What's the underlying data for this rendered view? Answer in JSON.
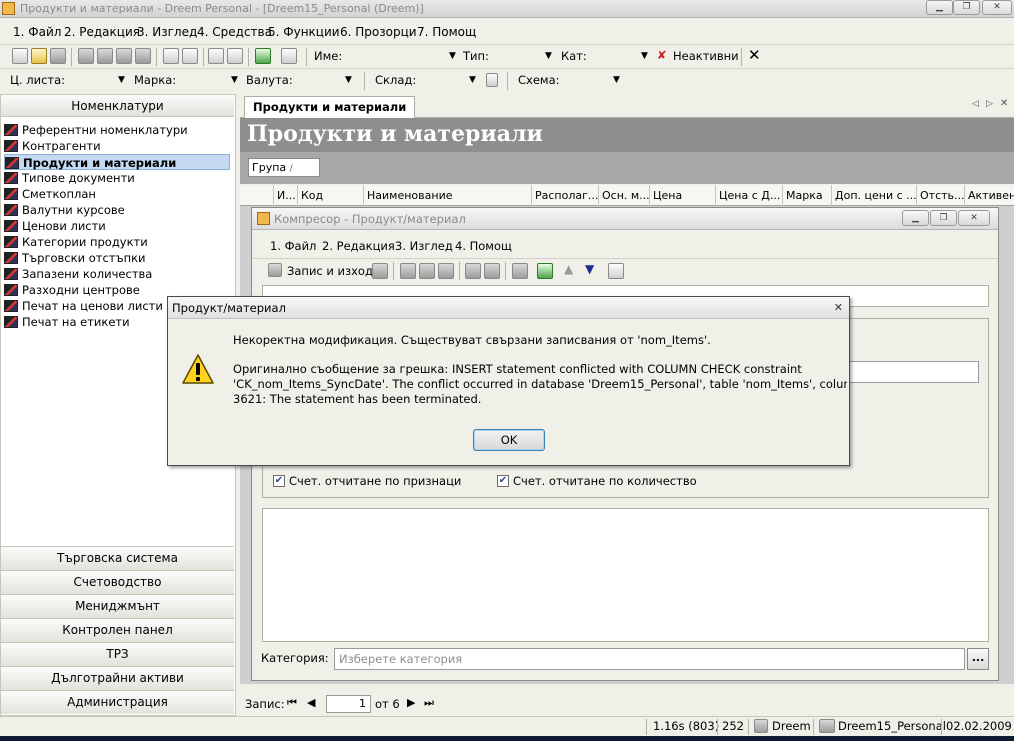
{
  "window": {
    "title": "Продукти и материали - Dreem Personal - [Dreem15_Personal (Dreem)]"
  },
  "menu": [
    "1. Файл",
    "2. Редакция",
    "3. Изглед",
    "4. Средства",
    "5. Функции",
    "6. Прозорци",
    "7. Помощ"
  ],
  "toolbar": {
    "name_label": "Име:",
    "type_label": "Тип:",
    "cat_label": "Кат:",
    "inactive_label": "Неактивни"
  },
  "filterbar": {
    "pricelist_label": "Ц. листа:",
    "brand_label": "Марка:",
    "currency_label": "Валута:",
    "warehouse_label": "Склад:",
    "scheme_label": "Схема:"
  },
  "sidebar": {
    "header": "Номенклатури",
    "items": [
      "Референтни номенклатури",
      "Контрагенти",
      "Продукти и материали",
      "Типове документи",
      "Сметкоплан",
      "Валутни курсове",
      "Ценови листи",
      "Категории продукти",
      "Търговски отстъпки",
      "Запазени количества",
      "Разходни центрове",
      "Печат на ценови листи",
      "Печат на етикети"
    ],
    "selected_index": 2,
    "sections": [
      "Търговска система",
      "Счетоводство",
      "Мениджмънт",
      "Контролен панел",
      "ТРЗ",
      "Дълготрайни активи",
      "Администрация"
    ]
  },
  "main": {
    "tab_label": "Продукти и материали",
    "title": "Продукти и материали",
    "group_label": "Група",
    "columns": [
      "И...",
      "Код",
      "Наименование",
      "Располаг...",
      "Осн. м...",
      "Цена",
      "Цена с Д...",
      "Марка",
      "Доп. цени с ...",
      "Отсть...",
      "Активен"
    ],
    "record": {
      "label": "Запис:",
      "current": "1",
      "of_label": "от 6"
    }
  },
  "child_window": {
    "title": "Компресор - Продукт/материал",
    "menu": [
      "1. Файл",
      "2. Редакция",
      "3. Изглед",
      "4. Помощ"
    ],
    "save_close_label": "Запис и изход",
    "checkbox1_label": "Счет. отчитане по признаци",
    "checkbox2_label": "Счет. отчитане по количество",
    "category_label": "Категория:",
    "category_placeholder": "Изберете категория",
    "browse_label": "..."
  },
  "dialog": {
    "title": "Продукт/материал",
    "line1": "Некоректна модификация. Съществуват свързани записвания от 'nom_Items'.",
    "line2": "Оригинално съобщение за грешка: INSERT statement conflicted with COLUMN CHECK constraint",
    "line3": "'CK_nom_Items_SyncDate'. The conflict occurred in database 'Dreem15_Personal', table 'nom_Items', column 'SyncD",
    "line4": "3621: The statement has been terminated.",
    "ok_label": "OK"
  },
  "statusbar": {
    "timing": "1.16s (803)",
    "count": "252",
    "user": "Dreem",
    "database": "Dreem15_Personal",
    "date": "02.02.2009"
  }
}
